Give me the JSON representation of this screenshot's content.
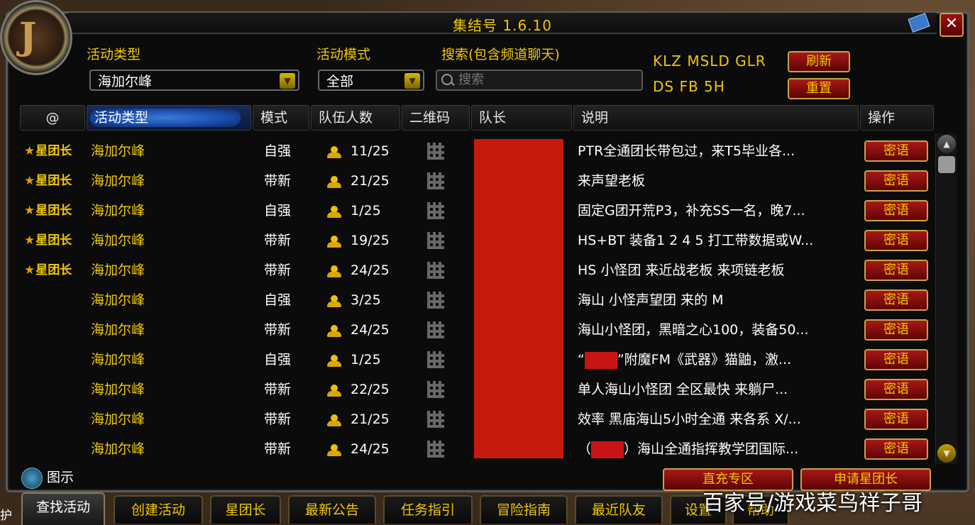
{
  "window": {
    "title": "集结号 1.6.10",
    "close_label": "✕"
  },
  "filters": {
    "activity_type_label": "活动类型",
    "activity_type_value": "海加尔峰",
    "activity_mode_label": "活动模式",
    "activity_mode_value": "全部",
    "search_label": "搜索(包含频道聊天)",
    "search_placeholder": "搜索",
    "quick_filters_line1": "KLZ  MSLD  GLR",
    "quick_filters_line2": "DS  FB  5H",
    "refresh_label": "刷新",
    "reset_label": "重置"
  },
  "columns": [
    "@",
    "活动类型",
    "模式",
    "队伍人数",
    "二维码",
    "队长",
    "说明",
    "操作"
  ],
  "rows": [
    {
      "badge": "星团长",
      "activity": "海加尔峰",
      "mode": "自强",
      "count": "11/25",
      "desc": "PTR全通团长带包过，来T5毕业各...",
      "action": "密语"
    },
    {
      "badge": "星团长",
      "activity": "海加尔峰",
      "mode": "带新",
      "count": "21/25",
      "desc": "来声望老板",
      "action": "密语"
    },
    {
      "badge": "星团长",
      "activity": "海加尔峰",
      "mode": "自强",
      "count": "1/25",
      "desc": "固定G团开荒P3，补充SS一名，晚7...",
      "action": "密语"
    },
    {
      "badge": "星团长",
      "activity": "海加尔峰",
      "mode": "带新",
      "count": "19/25",
      "desc": "HS+BT 装备1 2 4 5 打工带数据或W...",
      "action": "密语"
    },
    {
      "badge": "星团长",
      "activity": "海加尔峰",
      "mode": "带新",
      "count": "24/25",
      "desc": "HS 小怪团 来近战老板 来项链老板",
      "action": "密语"
    },
    {
      "badge": "",
      "activity": "海加尔峰",
      "mode": "自强",
      "count": "3/25",
      "desc": "海山 小怪声望团 来的 M",
      "action": "密语"
    },
    {
      "badge": "",
      "activity": "海加尔峰",
      "mode": "带新",
      "count": "24/25",
      "desc": "海山小怪团，黑暗之心100，装备50...",
      "action": "密语"
    },
    {
      "badge": "",
      "activity": "海加尔峰",
      "mode": "自强",
      "count": "1/25",
      "desc_pre": "“",
      "desc_post": "”附魔FM《武器》猫鼬，激...",
      "action": "密语"
    },
    {
      "badge": "",
      "activity": "海加尔峰",
      "mode": "带新",
      "count": "22/25",
      "desc": "单人海山小怪团 全区最快 来躺尸...",
      "action": "密语"
    },
    {
      "badge": "",
      "activity": "海加尔峰",
      "mode": "带新",
      "count": "21/25",
      "desc": "效率 黑庙海山5小时全通 来各系 X/...",
      "action": "密语"
    },
    {
      "badge": "",
      "activity": "海加尔峰",
      "mode": "带新",
      "count": "24/25",
      "desc_pre": "（",
      "desc_post": "）海山全通指挥教学团国际...",
      "action": "密语"
    }
  ],
  "footer": {
    "legend_label": "图示",
    "recharge_label": "直充专区",
    "apply_label": "申请星团长"
  },
  "tabs": [
    "查找活动",
    "创建活动",
    "星团长",
    "最新公告",
    "任务指引",
    "冒险指南",
    "最近队友",
    "设置",
    "帮助"
  ],
  "left_edge_text": "护",
  "watermark": "百家号/游戏菜鸟祥子哥",
  "colors": {
    "accent_gold": "#f0c800",
    "button_red": "#a81818",
    "header_blue": "#1a4aa8",
    "redaction": "#c81a0c"
  }
}
